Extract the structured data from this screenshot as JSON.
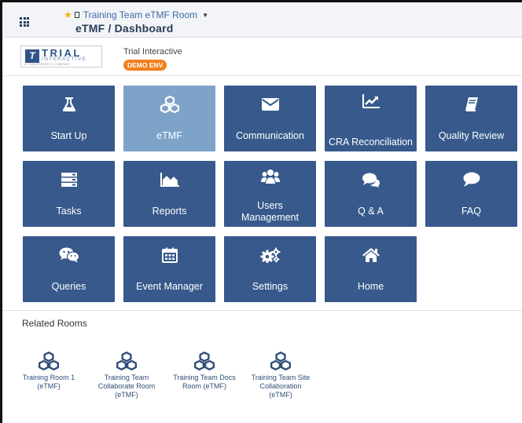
{
  "header": {
    "room_name": "Training Team eTMF Room",
    "breadcrumb": "eTMF / Dashboard"
  },
  "brand": {
    "logo_primary": "TRIAL",
    "logo_secondary": "INTERACTIVE",
    "logo_tagline": "A TRANSPERFECT COMPANY",
    "org_name": "Trial Interactive",
    "env_badge": "DEMO ENV"
  },
  "tiles": [
    {
      "label": "Start Up",
      "icon": "flask-icon"
    },
    {
      "label": "eTMF",
      "icon": "cubes-icon",
      "active": true
    },
    {
      "label": "Communication",
      "icon": "envelope-icon"
    },
    {
      "label": "CRA Reconciliation",
      "icon": "line-chart-icon"
    },
    {
      "label": "Quality Review",
      "icon": "book-icon"
    },
    {
      "label": "Tasks",
      "icon": "server-icon"
    },
    {
      "label": "Reports",
      "icon": "area-chart-icon"
    },
    {
      "label": "Users Management",
      "icon": "users-icon"
    },
    {
      "label": "Q & A",
      "icon": "comments-icon"
    },
    {
      "label": "FAQ",
      "icon": "comment-icon"
    },
    {
      "label": "Queries",
      "icon": "wechat-icon"
    },
    {
      "label": "Event Manager",
      "icon": "calendar-icon"
    },
    {
      "label": "Settings",
      "icon": "cogs-icon"
    },
    {
      "label": "Home",
      "icon": "home-icon"
    }
  ],
  "related": {
    "title": "Related Rooms",
    "rooms": [
      {
        "label": "Training Room 1 (eTMF)",
        "icon": "cubes-icon"
      },
      {
        "label": "Training Team Collaborate Room (eTMF)",
        "icon": "cubes-icon"
      },
      {
        "label": "Training Team Docs Room (eTMF)",
        "icon": "cubes-icon"
      },
      {
        "label": "Training Team Site Collaboration (eTMF)",
        "icon": "cubes-icon"
      }
    ]
  },
  "colors": {
    "tile_bg": "#37598b",
    "tile_active_bg": "#7ea3c9",
    "badge_bg": "#f0801e",
    "room_icon": "#2f4d78"
  }
}
